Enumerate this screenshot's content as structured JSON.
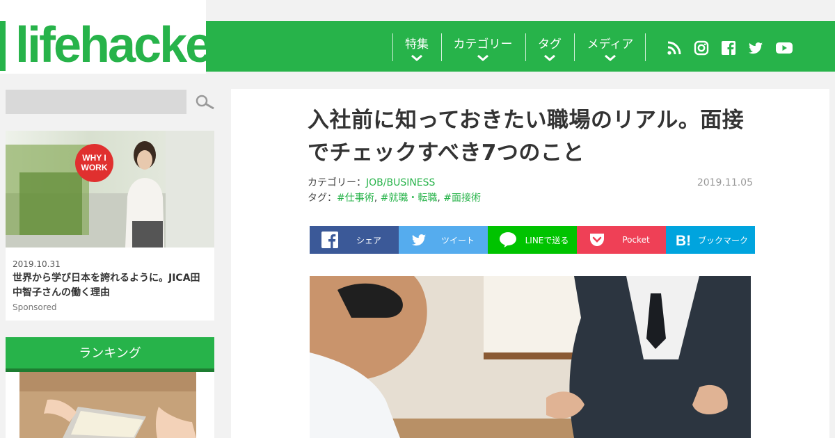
{
  "header": {
    "logo_text": "lifehacker",
    "nav": [
      {
        "label": "特集"
      },
      {
        "label": "カテゴリー"
      },
      {
        "label": "タグ"
      },
      {
        "label": "メディア"
      }
    ],
    "social_icons": [
      "rss-icon",
      "instagram-icon",
      "facebook-icon",
      "twitter-icon",
      "youtube-icon"
    ]
  },
  "sidebar": {
    "search": {
      "value": "",
      "placeholder": ""
    },
    "card": {
      "badge_line1": "WHY I",
      "badge_line2": "WORK",
      "date": "2019.10.31",
      "title": "世界から学び日本を誇れるように。JICA田中智子さんの働く理由",
      "sponsored": "Sponsored"
    },
    "ranking": {
      "title": "ランキング"
    }
  },
  "article": {
    "title": "入社前に知っておきたい職場のリアル。面接でチェックすべき7つのこと",
    "category_label": "カテゴリー：",
    "category_link": "JOB/BUSINESS",
    "tag_label": "タグ：",
    "tags": [
      "#仕事術",
      "#就職・転職",
      "#面接術"
    ],
    "date": "2019.11.05"
  },
  "share": [
    {
      "label": "シェア",
      "icon": "facebook-icon",
      "color": "#3b5998"
    },
    {
      "label": "ツイート",
      "icon": "twitter-icon",
      "color": "#55acee"
    },
    {
      "label": "LINEで送る",
      "icon": "line-icon",
      "color": "#00c300"
    },
    {
      "label": "Pocket",
      "icon": "pocket-icon",
      "color": "#ef4056"
    },
    {
      "label": "ブックマーク",
      "icon": "hatena-bookmark-icon",
      "color": "#00a4de"
    }
  ],
  "colors": {
    "brand": "#27b34a",
    "brand_dark": "#1d7d31"
  }
}
